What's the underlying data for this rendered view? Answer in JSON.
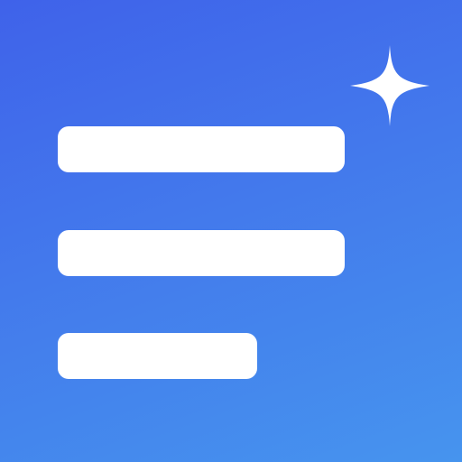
{
  "icon": {
    "name": "menu-lines-sparkle-icon",
    "colors": {
      "gradient_start": "#3f62ea",
      "gradient_end": "#4694ee",
      "foreground": "#ffffff"
    },
    "lines": [
      {
        "name": "line-1",
        "length_fraction": 1.0
      },
      {
        "name": "line-2",
        "length_fraction": 1.0
      },
      {
        "name": "line-3",
        "length_fraction": 0.69
      }
    ],
    "accent": "four-point-sparkle"
  }
}
